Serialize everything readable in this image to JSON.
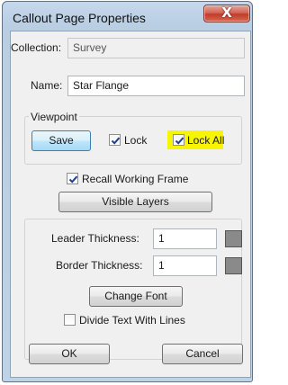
{
  "window": {
    "title": "Callout Page Properties",
    "close_glyph": "X"
  },
  "collection": {
    "label": "Collection:",
    "value": "Survey"
  },
  "name": {
    "label": "Name:",
    "value": "Star Flange"
  },
  "viewpoint": {
    "group_label": "Viewpoint",
    "save_label": "Save",
    "lock_label": "Lock",
    "lock_checked": true,
    "lock_all_label": "Lock All",
    "lock_all_checked": true,
    "lock_all_highlight": "#f5f505"
  },
  "recall_working_frame": {
    "label": "Recall Working Frame",
    "checked": true
  },
  "visible_layers_label": "Visible Layers",
  "leader_thickness": {
    "label": "Leader Thickness:",
    "value": "1",
    "color": "#8a8a8a"
  },
  "border_thickness": {
    "label": "Border Thickness:",
    "value": "1",
    "color": "#8a8a8a"
  },
  "change_font_label": "Change Font",
  "divide_text": {
    "label": "Divide Text With Lines",
    "checked": false
  },
  "ok_label": "OK",
  "cancel_label": "Cancel"
}
